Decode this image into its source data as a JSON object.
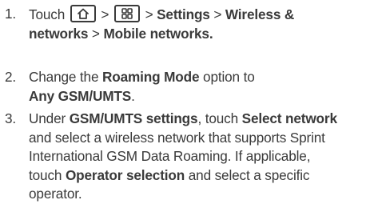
{
  "steps": [
    {
      "number": "1.",
      "parts": {
        "touch": "Touch",
        "gt1": ">",
        "gt2": ">",
        "settings": "Settings",
        "gt3": ">",
        "wireless_line1": "Wireless &",
        "wireless_line2": "networks",
        "gt4": ">",
        "mobile": "Mobile networks."
      },
      "icons": [
        "home-key-icon",
        "menu-key-icon"
      ]
    },
    {
      "number": "2.",
      "parts": {
        "text1": "Change the",
        "roaming": "Roaming Mode",
        "text2": "option to",
        "any": "Any GSM/UMTS",
        "period": "."
      }
    },
    {
      "number": "3.",
      "parts": {
        "under": "Under",
        "gsm": "GSM/UMTS settings",
        "comma_touch": ", touch",
        "select_network": "Select network",
        "line2": "and select a wireless network that supports Sprint",
        "line3": "International GSM Data Roaming. If applicable,",
        "line4_touch": "touch",
        "operator": "Operator selection",
        "line4_rest": "and select a specific",
        "line5": "operator."
      }
    }
  ]
}
